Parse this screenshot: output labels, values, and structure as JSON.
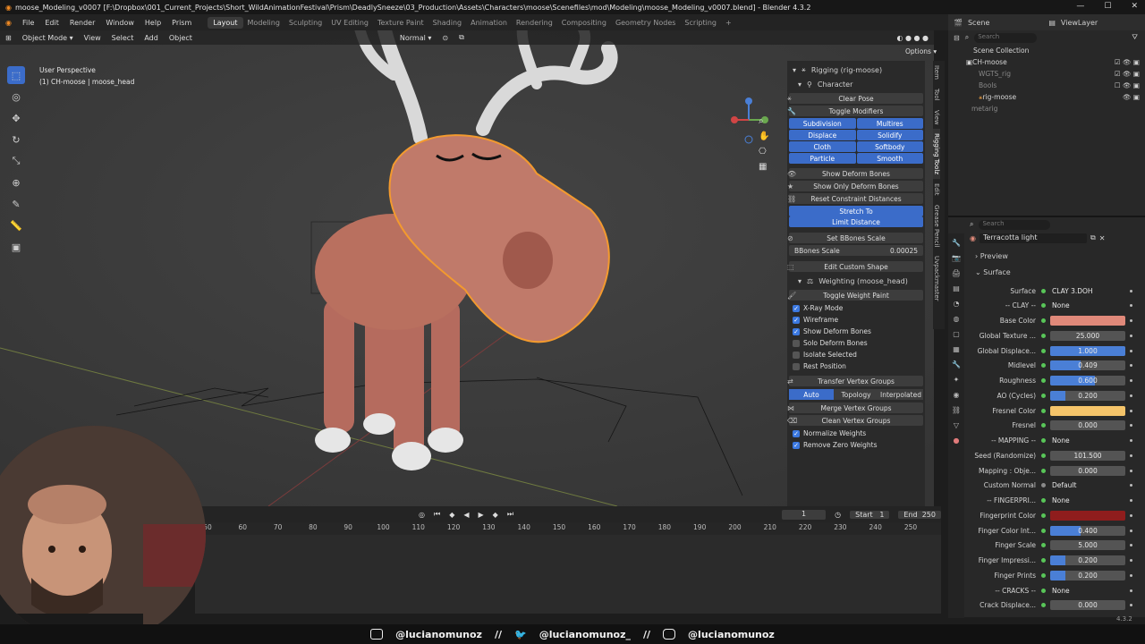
{
  "titlebar": {
    "title": "moose_Modeling_v0007 [F:\\Dropbox\\001_Current_Projects\\Short_WildAnimationFestival\\Prism\\DeadlySneeze\\03_Production\\Assets\\Characters\\moose\\Scenefiles\\mod\\Modeling\\moose_Modeling_v0007.blend] - Blender 4.3.2"
  },
  "menubar": {
    "menus": [
      "File",
      "Edit",
      "Render",
      "Window",
      "Help",
      "Prism"
    ],
    "workspaces": [
      "Layout",
      "Modeling",
      "Sculpting",
      "UV Editing",
      "Texture Paint",
      "Shading",
      "Animation",
      "Rendering",
      "Compositing",
      "Geometry Nodes",
      "Scripting"
    ],
    "active_workspace": "Layout",
    "add_tab": "+",
    "scene_label": "Scene",
    "viewlayer_label": "ViewLayer"
  },
  "viewport_header": {
    "mode": "Object Mode",
    "menus": [
      "View",
      "Select",
      "Add",
      "Object"
    ],
    "orientation": "Normal",
    "options": "Options"
  },
  "viewport": {
    "perspective": "User Perspective",
    "object": "(1) CH-moose | moose_head"
  },
  "npanel": {
    "rigging_title": "Rigging (rig-moose)",
    "character": "Character",
    "clear_pose": "Clear Pose",
    "toggle_modifiers": "Toggle Modifiers",
    "modifiers": [
      "Subdivision",
      "Multires",
      "Displace",
      "Solidify",
      "Cloth",
      "Softbody",
      "Particle",
      "Smooth"
    ],
    "show_deform": "Show Deform Bones",
    "show_only_deform": "Show Only Deform Bones",
    "reset_constraint": "Reset Constraint Distances",
    "stretch_to": "Stretch To",
    "limit_distance": "Limit Distance",
    "set_bbones": "Set BBones Scale",
    "bbones_label": "BBones Scale",
    "bbones_value": "0.00025",
    "edit_custom_shape": "Edit Custom Shape",
    "weighting_title": "Weighting (moose_head)",
    "toggle_weight_paint": "Toggle Weight Paint",
    "checks": [
      {
        "label": "X-Ray Mode",
        "on": true
      },
      {
        "label": "Wireframe",
        "on": true
      },
      {
        "label": "Show Deform Bones",
        "on": true
      },
      {
        "label": "Solo Deform Bones",
        "on": false
      },
      {
        "label": "Isolate Selected",
        "on": false
      },
      {
        "label": "Rest Position",
        "on": false
      }
    ],
    "transfer_vg": "Transfer Vertex Groups",
    "transfer_modes": [
      "Auto",
      "Topology",
      "Interpolated"
    ],
    "merge_vg": "Merge Vertex Groups",
    "clean_vg": "Clean Vertex Groups",
    "checks2": [
      {
        "label": "Normalize Weights",
        "on": true
      },
      {
        "label": "Remove Zero Weights",
        "on": true
      }
    ]
  },
  "vtabs": [
    "Item",
    "Tool",
    "View",
    "Rigging Toolz",
    "Edit",
    "Grease Pencil",
    "Uvpackmaster"
  ],
  "outliner": {
    "search_placeholder": "Search",
    "items": [
      {
        "label": "Scene Collection",
        "indent": 0
      },
      {
        "label": "CH-moose",
        "indent": 1
      },
      {
        "label": "WGTS_rig",
        "indent": 2
      },
      {
        "label": "Bools",
        "indent": 2
      },
      {
        "label": "rig-moose",
        "indent": 2
      },
      {
        "label": "metarig",
        "indent": 1
      }
    ]
  },
  "properties": {
    "search_placeholder": "Search",
    "material": "Terracotta light",
    "preview": "Preview",
    "surface_header": "Surface",
    "rows": [
      {
        "label": "Surface",
        "value": "CLAY 3.DOH",
        "kind": "plain"
      },
      {
        "label": "-- CLAY --",
        "value": "None",
        "kind": "plain"
      },
      {
        "label": "Base Color",
        "value": "",
        "kind": "color",
        "color": "#e0897a"
      },
      {
        "label": "Global Texture ...",
        "value": "25.000",
        "kind": "num"
      },
      {
        "label": "Global Displace...",
        "value": "1.000",
        "kind": "slider",
        "fill": 1.0
      },
      {
        "label": "Midlevel",
        "value": "0.409",
        "kind": "slider",
        "fill": 0.409
      },
      {
        "label": "Roughness",
        "value": "0.600",
        "kind": "slider",
        "fill": 0.6
      },
      {
        "label": "AO (Cycles)",
        "value": "0.200",
        "kind": "slider",
        "fill": 0.2
      },
      {
        "label": "Fresnel Color",
        "value": "",
        "kind": "color",
        "color": "#f5c46a"
      },
      {
        "label": "Fresnel",
        "value": "0.000",
        "kind": "num"
      },
      {
        "label": "-- MAPPING --",
        "value": "None",
        "kind": "plain"
      },
      {
        "label": "Seed (Randomize)",
        "value": "101.500",
        "kind": "num"
      },
      {
        "label": "Mapping : Obje...",
        "value": "0.000",
        "kind": "num"
      },
      {
        "label": "Custom Normal",
        "value": "Default",
        "kind": "plain"
      },
      {
        "label": "-- FINGERPRI...",
        "value": "None",
        "kind": "plain"
      },
      {
        "label": "Fingerprint Color",
        "value": "",
        "kind": "color",
        "color": "#8f1d1d"
      },
      {
        "label": "Finger Color Int...",
        "value": "0.400",
        "kind": "slider",
        "fill": 0.4
      },
      {
        "label": "Finger Scale",
        "value": "5.000",
        "kind": "num"
      },
      {
        "label": "Finger Impressi...",
        "value": "0.200",
        "kind": "slider",
        "fill": 0.2
      },
      {
        "label": "Finger Prints",
        "value": "0.200",
        "kind": "slider",
        "fill": 0.2
      },
      {
        "label": "-- CRACKS --",
        "value": "None",
        "kind": "plain"
      },
      {
        "label": "Crack Displace...",
        "value": "0.000",
        "kind": "num"
      }
    ]
  },
  "timeline": {
    "current_frame": "1",
    "start_label": "Start",
    "start": "1",
    "end_label": "End",
    "end": "250",
    "ticks": [
      "50",
      "60",
      "70",
      "80",
      "90",
      "100",
      "110",
      "120",
      "130",
      "140",
      "150",
      "160",
      "170",
      "180",
      "190",
      "200",
      "210",
      "220",
      "230",
      "240",
      "250"
    ]
  },
  "statusbar": {
    "version": "4.3.2"
  },
  "social": {
    "youtube": "@lucianomunoz",
    "sep": "//",
    "twitter": "@lucianomunoz_",
    "instagram": "@lucianomunoz"
  }
}
